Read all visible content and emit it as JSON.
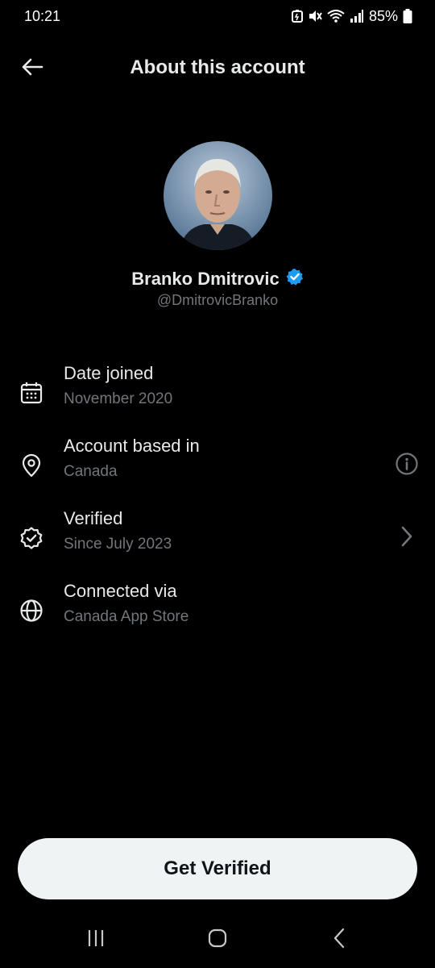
{
  "status_bar": {
    "time": "10:21",
    "battery": "85%",
    "icons": [
      "battery-saver-icon",
      "mute-icon",
      "wifi-icon",
      "signal-icon",
      "battery-icon"
    ]
  },
  "header": {
    "title": "About this account",
    "back_icon": "back-arrow-icon"
  },
  "profile": {
    "name": "Branko Dmitrovic",
    "handle": "@DmitrovicBranko",
    "verified_badge_color": "#1d9bf0"
  },
  "details": [
    {
      "icon": "calendar-icon",
      "title": "Date joined",
      "subtitle": "November 2020"
    },
    {
      "icon": "location-pin-icon",
      "title": "Account based in",
      "subtitle": "Canada",
      "trailing": "info-icon"
    },
    {
      "icon": "verified-badge-icon",
      "title": "Verified",
      "subtitle": "Since July 2023",
      "trailing": "chevron-right-icon"
    },
    {
      "icon": "globe-icon",
      "title": "Connected via",
      "subtitle": "Canada App Store"
    }
  ],
  "cta": {
    "label": "Get Verified"
  },
  "nav_bar": {
    "buttons": [
      "recent-apps-icon",
      "home-icon",
      "back-icon"
    ]
  },
  "colors": {
    "background": "#000000",
    "primary_text": "#e7e9ea",
    "secondary_text": "#71767b",
    "accent": "#1d9bf0",
    "button_bg": "#eff3f4"
  }
}
